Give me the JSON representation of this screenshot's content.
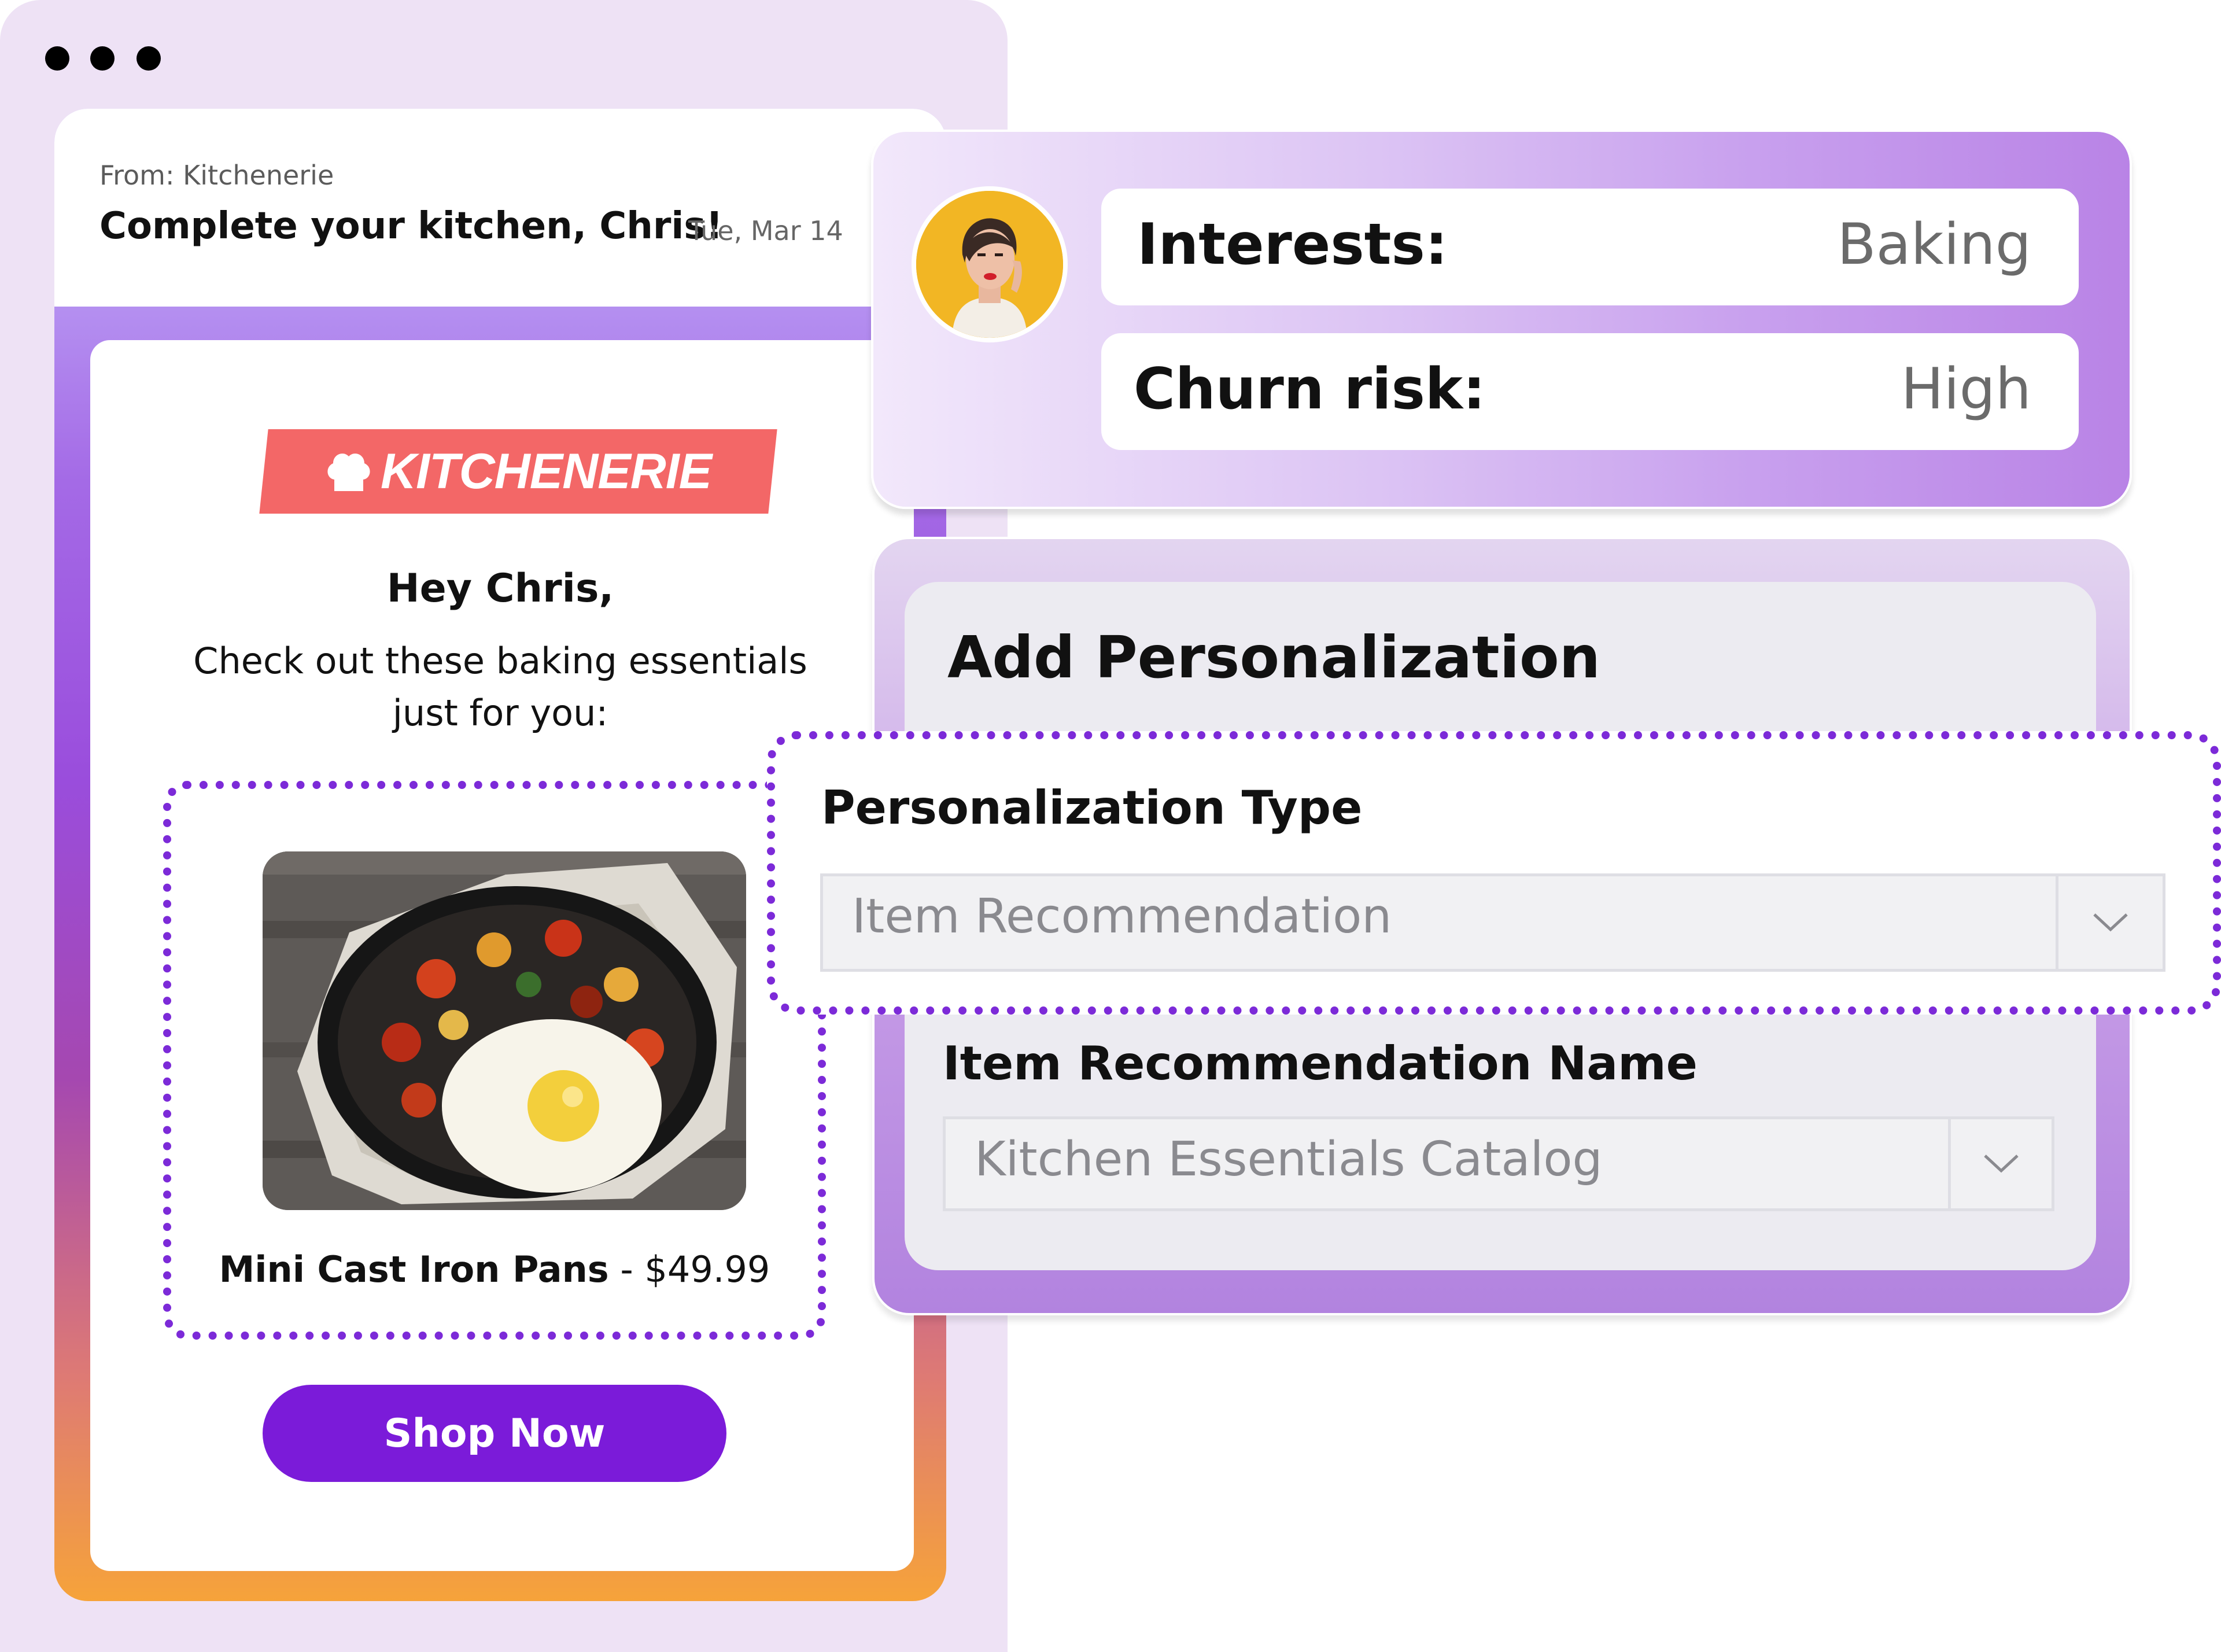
{
  "window": {
    "controls": [
      "dot",
      "dot",
      "dot"
    ]
  },
  "email": {
    "from": "From: Kitchenerie",
    "subject": "Complete your kitchen, Chris!",
    "date": "Tue, Mar 14",
    "logo_text": "KITCHENERIE",
    "logo_icon": "chef-hat-icon",
    "greeting": "Hey Chris,",
    "intro_line1": "Check out these baking essentials",
    "intro_line2": "just for you:",
    "product": {
      "name": "Mini Cast Iron Pans",
      "separator": " - ",
      "price": "$49.99",
      "image": "skillet-with-egg-and-vegetables"
    },
    "cta_label": "Shop Now"
  },
  "profile": {
    "avatar": "avatar-woman-photo",
    "attributes": [
      {
        "label": "Interests:",
        "value": "Baking"
      },
      {
        "label": "Churn risk:",
        "value": "High"
      }
    ]
  },
  "personalization": {
    "title": "Add Personalization",
    "type_label": "Personalization Type",
    "type_value": "Item Recommendation",
    "name_label": "Item Recommendation Name",
    "name_value": "Kitchen Essentials Catalog",
    "caret_icon": "chevron-down-icon"
  },
  "colors": {
    "accent_purple": "#7b1bd9",
    "dotted_outline": "#7c2ad8",
    "logo_red": "#f36767",
    "frame_bg": "#eee2f5"
  }
}
